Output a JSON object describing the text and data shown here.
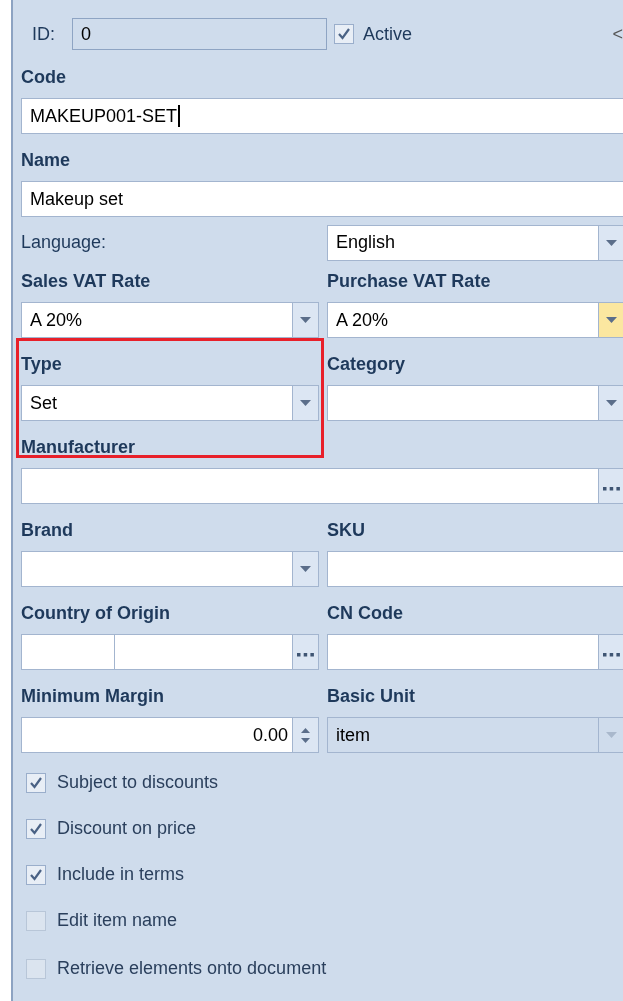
{
  "header": {
    "id_label": "ID:",
    "id_value": "0",
    "active": {
      "label": "Active",
      "checked": true
    },
    "collapse": "<"
  },
  "blocks": [
    {
      "fields": [
        {
          "kind": "text",
          "label": "Code",
          "value": "MAKEUP001-SET",
          "focused": true
        }
      ]
    },
    {
      "fields": [
        {
          "kind": "text",
          "label": "Name",
          "value": "Makeup set",
          "focused": false
        }
      ]
    },
    {
      "inline": true,
      "fields": [
        {
          "kind": "combo",
          "label": "Language:",
          "value": "English",
          "hovered": false,
          "disabled": false
        }
      ]
    },
    {
      "fields": [
        {
          "kind": "combo",
          "label": "Sales VAT Rate",
          "value": "A 20%",
          "hovered": false,
          "disabled": false
        },
        {
          "kind": "combo",
          "label": "Purchase VAT Rate",
          "value": "A 20%",
          "hovered": true,
          "disabled": false
        }
      ]
    },
    {
      "highlighted": true,
      "fields": [
        {
          "kind": "combo",
          "label": "Type",
          "value": "Set",
          "hovered": false,
          "disabled": false
        },
        {
          "kind": "combo",
          "label": "Category",
          "hovered": false,
          "disabled": false
        }
      ]
    },
    {
      "fields": [
        {
          "kind": "lookup",
          "label": "Manufacturer"
        }
      ]
    },
    {
      "fields": [
        {
          "kind": "combo",
          "label": "Brand",
          "hovered": false,
          "disabled": false
        },
        {
          "kind": "text",
          "label": "SKU",
          "focused": false
        }
      ]
    },
    {
      "fields": [
        {
          "kind": "country",
          "label": "Country of Origin"
        },
        {
          "kind": "lookup",
          "label": "CN Code"
        }
      ]
    },
    {
      "fields": [
        {
          "kind": "spin",
          "label": "Minimum Margin",
          "value": "0.00"
        },
        {
          "kind": "combo",
          "label": "Basic Unit",
          "value": "item",
          "hovered": false,
          "disabled": true
        }
      ]
    }
  ],
  "checkboxes": [
    {
      "label": "Subject to discounts",
      "checked": true,
      "disabled": false
    },
    {
      "label": "Discount on price",
      "checked": true,
      "disabled": false
    },
    {
      "label": "Include in terms",
      "checked": true,
      "disabled": false
    },
    {
      "label": "Edit item name",
      "checked": false,
      "disabled": true
    },
    {
      "label": "Retrieve elements onto document",
      "checked": false,
      "disabled": true
    }
  ]
}
